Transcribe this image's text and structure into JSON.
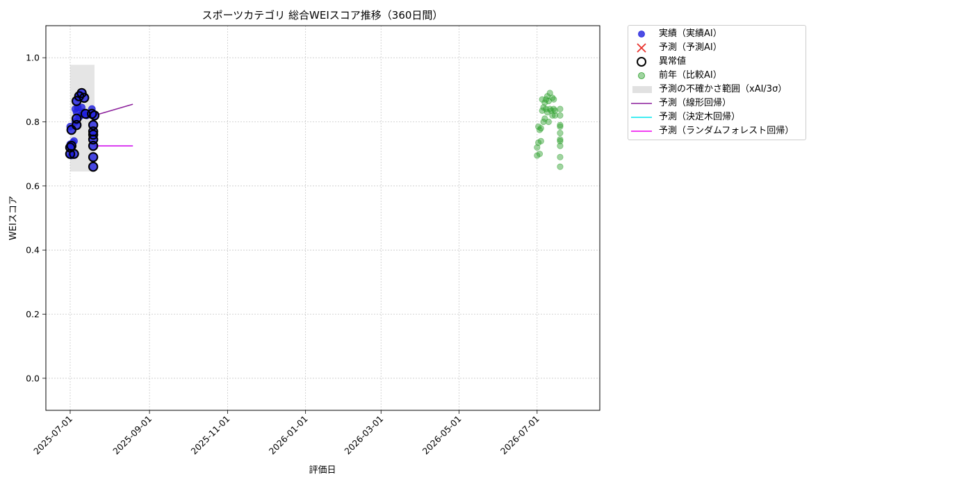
{
  "chart_data": {
    "type": "scatter",
    "title": "スポーツカテゴリ 総合WEIスコア推移（360日間）",
    "xlabel": "評価日",
    "ylabel": "WEIスコア",
    "xlim": [
      "2025-06-12",
      "2026-08-19"
    ],
    "ylim": [
      -0.1,
      1.1
    ],
    "grid": true,
    "legend_position": "outside-top-right",
    "xticks": [
      "2025-07-01",
      "2025-09-01",
      "2025-11-01",
      "2026-01-01",
      "2026-03-01",
      "2026-05-01",
      "2026-07-01"
    ],
    "yticks": [
      "0.0",
      "0.2",
      "0.4",
      "0.6",
      "0.8",
      "1.0"
    ],
    "uncertainty_band": {
      "x_start": "2025-07-01",
      "x_end": "2025-07-20",
      "y_low": 0.645,
      "y_high": 0.978
    },
    "series": [
      {
        "name": "実績（実績AI）",
        "kind": "scatter",
        "color": "#1f1fdd",
        "points": [
          [
            "2025-07-01",
            0.72
          ],
          [
            "2025-07-01",
            0.7
          ],
          [
            "2025-07-01",
            0.73
          ],
          [
            "2025-07-01",
            0.785
          ],
          [
            "2025-07-02",
            0.695
          ],
          [
            "2025-07-02",
            0.725
          ],
          [
            "2025-07-02",
            0.775
          ],
          [
            "2025-07-03",
            0.735
          ],
          [
            "2025-07-04",
            0.74
          ],
          [
            "2025-07-04",
            0.7
          ],
          [
            "2025-07-05",
            0.8
          ],
          [
            "2025-07-05",
            0.81
          ],
          [
            "2025-07-05",
            0.84
          ],
          [
            "2025-07-06",
            0.865
          ],
          [
            "2025-07-06",
            0.83
          ],
          [
            "2025-07-06",
            0.79
          ],
          [
            "2025-07-07",
            0.875
          ],
          [
            "2025-07-07",
            0.845
          ],
          [
            "2025-07-08",
            0.88
          ],
          [
            "2025-07-08",
            0.815
          ],
          [
            "2025-07-09",
            0.885
          ],
          [
            "2025-07-09",
            0.82
          ],
          [
            "2025-07-10",
            0.89
          ],
          [
            "2025-07-10",
            0.845
          ],
          [
            "2025-07-11",
            0.83
          ],
          [
            "2025-07-12",
            0.875
          ],
          [
            "2025-07-13",
            0.825
          ],
          [
            "2025-07-14",
            0.82
          ],
          [
            "2025-07-18",
            0.84
          ],
          [
            "2025-07-18",
            0.825
          ],
          [
            "2025-07-19",
            0.79
          ],
          [
            "2025-07-19",
            0.77
          ],
          [
            "2025-07-19",
            0.76
          ],
          [
            "2025-07-19",
            0.745
          ],
          [
            "2025-07-19",
            0.725
          ],
          [
            "2025-07-19",
            0.69
          ],
          [
            "2025-07-19",
            0.66
          ],
          [
            "2025-07-20",
            0.82
          ]
        ]
      },
      {
        "name": "異常値",
        "kind": "ring",
        "color": "#000000",
        "points": [
          [
            "2025-07-01",
            0.72
          ],
          [
            "2025-07-01",
            0.7
          ],
          [
            "2025-07-02",
            0.725
          ],
          [
            "2025-07-02",
            0.775
          ],
          [
            "2025-07-04",
            0.7
          ],
          [
            "2025-07-06",
            0.865
          ],
          [
            "2025-07-06",
            0.79
          ],
          [
            "2025-07-06",
            0.81
          ],
          [
            "2025-07-08",
            0.88
          ],
          [
            "2025-07-10",
            0.89
          ],
          [
            "2025-07-12",
            0.875
          ],
          [
            "2025-07-13",
            0.825
          ],
          [
            "2025-07-18",
            0.825
          ],
          [
            "2025-07-19",
            0.79
          ],
          [
            "2025-07-19",
            0.77
          ],
          [
            "2025-07-19",
            0.76
          ],
          [
            "2025-07-19",
            0.745
          ],
          [
            "2025-07-19",
            0.725
          ],
          [
            "2025-07-19",
            0.69
          ],
          [
            "2025-07-19",
            0.66
          ],
          [
            "2025-07-20",
            0.82
          ]
        ]
      },
      {
        "name": "前年（比較AI）",
        "kind": "scatter",
        "color": "#2ca02c",
        "points": [
          [
            "2026-07-01",
            0.72
          ],
          [
            "2026-07-01",
            0.695
          ],
          [
            "2026-07-02",
            0.785
          ],
          [
            "2026-07-02",
            0.735
          ],
          [
            "2026-07-03",
            0.7
          ],
          [
            "2026-07-03",
            0.775
          ],
          [
            "2026-07-04",
            0.74
          ],
          [
            "2026-07-04",
            0.78
          ],
          [
            "2026-07-05",
            0.87
          ],
          [
            "2026-07-05",
            0.835
          ],
          [
            "2026-07-06",
            0.845
          ],
          [
            "2026-07-06",
            0.8
          ],
          [
            "2026-07-07",
            0.86
          ],
          [
            "2026-07-07",
            0.81
          ],
          [
            "2026-07-08",
            0.87
          ],
          [
            "2026-07-08",
            0.84
          ],
          [
            "2026-07-09",
            0.88
          ],
          [
            "2026-07-09",
            0.83
          ],
          [
            "2026-07-10",
            0.865
          ],
          [
            "2026-07-10",
            0.8
          ],
          [
            "2026-07-11",
            0.89
          ],
          [
            "2026-07-11",
            0.84
          ],
          [
            "2026-07-12",
            0.835
          ],
          [
            "2026-07-13",
            0.82
          ],
          [
            "2026-07-13",
            0.875
          ],
          [
            "2026-07-14",
            0.87
          ],
          [
            "2026-07-14",
            0.84
          ],
          [
            "2026-07-15",
            0.835
          ],
          [
            "2026-07-15",
            0.82
          ],
          [
            "2026-07-19",
            0.79
          ],
          [
            "2026-07-19",
            0.785
          ],
          [
            "2026-07-19",
            0.765
          ],
          [
            "2026-07-19",
            0.745
          ],
          [
            "2026-07-19",
            0.74
          ],
          [
            "2026-07-19",
            0.725
          ],
          [
            "2026-07-19",
            0.69
          ],
          [
            "2026-07-19",
            0.66
          ],
          [
            "2026-07-19",
            0.84
          ],
          [
            "2026-07-19",
            0.82
          ]
        ]
      },
      {
        "name": "予測（線形回帰）",
        "kind": "line",
        "color": "#8b1f9b",
        "points": [
          [
            "2025-07-20",
            0.82
          ],
          [
            "2025-08-19",
            0.855
          ]
        ]
      },
      {
        "name": "予測（決定木回帰）",
        "kind": "line",
        "color": "#00e5ee",
        "points": [
          [
            "2025-07-20",
            0.725
          ],
          [
            "2025-08-19",
            0.725
          ]
        ]
      },
      {
        "name": "予測（ランダムフォレスト回帰）",
        "kind": "line",
        "color": "#ee00ee",
        "points": [
          [
            "2025-07-20",
            0.725
          ],
          [
            "2025-08-19",
            0.725
          ]
        ]
      }
    ]
  },
  "legend": {
    "items": [
      {
        "key": "actual",
        "label": "実績（実績AI）",
        "symbol": "dot",
        "color": "#1f1fdd"
      },
      {
        "key": "pred",
        "label": "予測（予測AI）",
        "symbol": "x",
        "color": "#e8302a"
      },
      {
        "key": "anomaly",
        "label": "異常値",
        "symbol": "ring",
        "color": "#000000"
      },
      {
        "key": "prev",
        "label": "前年（比較AI）",
        "symbol": "dot",
        "color": "#2ca02c"
      },
      {
        "key": "band",
        "label": "予測の不確かさ範囲（xAI/3σ）",
        "symbol": "rect",
        "color": "#d9d9d9"
      },
      {
        "key": "linear",
        "label": "予測（線形回帰）",
        "symbol": "line",
        "color": "#8b1f9b"
      },
      {
        "key": "tree",
        "label": "予測（決定木回帰）",
        "symbol": "line",
        "color": "#00e5ee"
      },
      {
        "key": "forest",
        "label": "予測（ランダムフォレスト回帰）",
        "symbol": "line",
        "color": "#ee00ee"
      }
    ]
  }
}
